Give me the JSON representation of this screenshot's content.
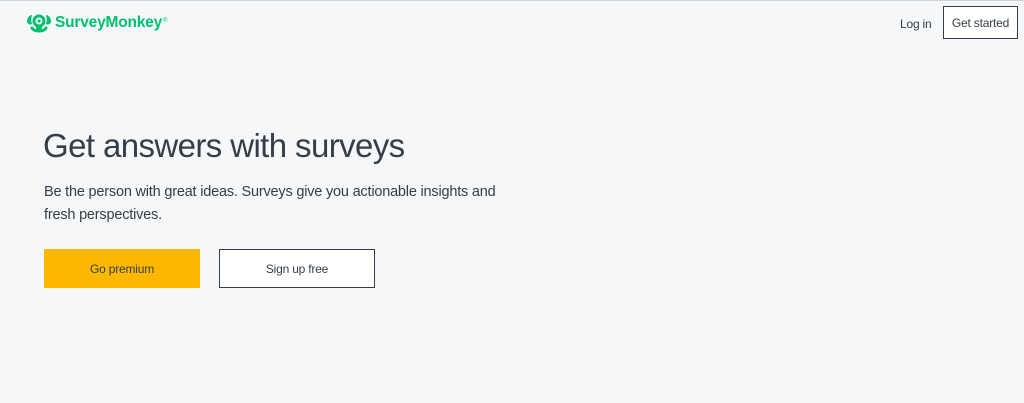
{
  "header": {
    "logo_text": "SurveyMonkey",
    "logo_reg": "®",
    "login_label": "Log in",
    "get_started_label": "Get started"
  },
  "hero": {
    "title": "Get answers with surveys",
    "subtitle": "Be the person with great ideas. Surveys give you actionable insights and fresh perspectives.",
    "premium_label": "Go premium",
    "signup_label": "Sign up free"
  },
  "colors": {
    "brand": "#00bf6f",
    "primary_button": "#ffb800",
    "text": "#333e48",
    "background": "#f6f7f9"
  },
  "icons": {
    "logo": "surveymonkey-logo-icon"
  }
}
